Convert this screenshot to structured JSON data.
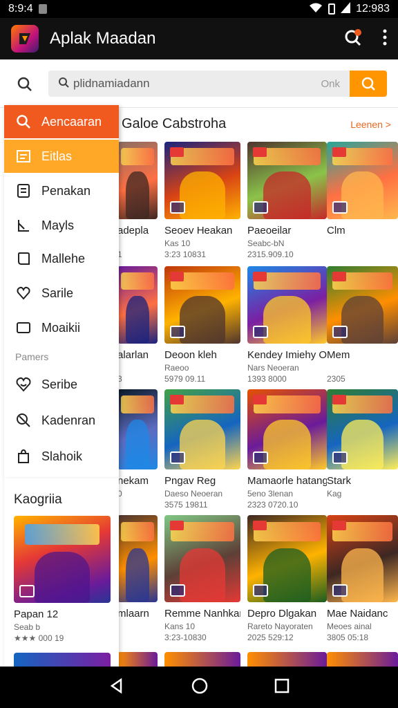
{
  "status": {
    "left_time": "8:9:4",
    "right_time": "12:983"
  },
  "appbar": {
    "title": "Aplak Maadan"
  },
  "search": {
    "value": "plidnamiadann",
    "hint": "Onk"
  },
  "section": {
    "title": "Galoe Cabstroha",
    "link": "Leenen >"
  },
  "drawer": {
    "items": [
      {
        "label": "Aencaaran",
        "icon": "search-icon"
      },
      {
        "label": "Eitlas",
        "icon": "list-box-icon"
      },
      {
        "label": "Penakan",
        "icon": "document-icon"
      },
      {
        "label": "Mayls",
        "icon": "arrow-chart-icon"
      },
      {
        "label": "Mallehe",
        "icon": "chat-bubble-icon"
      },
      {
        "label": "Sarile",
        "icon": "heart-icon"
      },
      {
        "label": "Moaikii",
        "icon": "square-icon"
      }
    ],
    "section_label": "Pamers",
    "items2": [
      {
        "label": "Seribe",
        "icon": "heart-smile-icon"
      },
      {
        "label": "Kadenran",
        "icon": "magnify-tool-icon"
      },
      {
        "label": "Slahoik",
        "icon": "bag-icon"
      }
    ]
  },
  "categories": {
    "title": "Kaogriia",
    "card": {
      "title": "Papan 12",
      "sub": "Seab b",
      "meta": "★★★ 000 19"
    }
  },
  "games": [
    {
      "title": "adepla",
      "sub": "",
      "meta": "1"
    },
    {
      "title": "Seoev Heakan",
      "sub": "Kas 10",
      "meta": "3:23 10831"
    },
    {
      "title": "Paeoeilar",
      "sub": "Seabc-bN",
      "meta": "2315.909.10"
    },
    {
      "title": "Clm",
      "sub": "",
      "meta": ""
    },
    {
      "title": "alarlan",
      "sub": "",
      "meta": "3"
    },
    {
      "title": "Deoon kleh",
      "sub": "Raeoo",
      "meta": "5979 09.11"
    },
    {
      "title": "Kendey Imiehy Oinan",
      "sub": "Nars Neoeran",
      "meta": "1393 8000"
    },
    {
      "title": "Mem",
      "sub": "",
      "meta": "2305"
    },
    {
      "title": "nekam",
      "sub": "0",
      "meta": ""
    },
    {
      "title": "Pngav Reg",
      "sub": "Daeso Neoeran",
      "meta": "3575 19811"
    },
    {
      "title": "Mamaorle hatang",
      "sub": "5eno 3lenan",
      "meta": "2323 0720.10"
    },
    {
      "title": "Stark",
      "sub": "Kag",
      "meta": ""
    },
    {
      "title": "mlaarn",
      "sub": "",
      "meta": ""
    },
    {
      "title": "Remme Nanhkan",
      "sub": "Kans 10",
      "meta": "3:23-10830"
    },
    {
      "title": "Depro Dlgakan",
      "sub": "Rareto Nayoraten",
      "meta": "2025 529:12"
    },
    {
      "title": "Mae Naidanc",
      "sub": "Meoes ainal",
      "meta": "3805 05:18"
    }
  ],
  "colors": {
    "accent": "#f05a1e",
    "accent2": "#ffa726",
    "search_button": "#ff9500"
  }
}
